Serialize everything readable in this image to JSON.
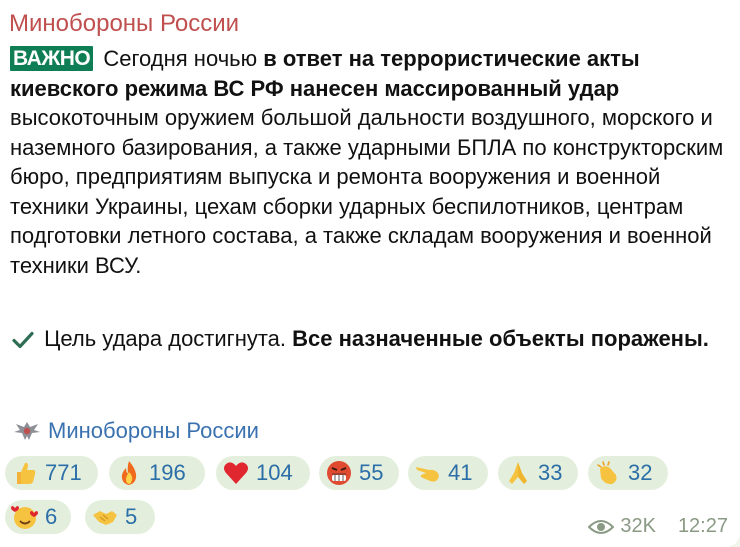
{
  "post": {
    "channel_name": "Минобороны России",
    "badge": "ВАЖНО",
    "text_1": " Сегодня ночью ",
    "text_bold_1": "в ответ на террористические акты киевского режима ВС РФ нанесен массированный удар",
    "text_2": " высокоточным оружием большой дальности воздушного, морского и наземного базирования, а также ударными БПЛА по конструкторским бюро, предприятиям выпуска и ремонта вооружения и военной техники Украины, цехам сборки ударных беспилотников, центрам подготовки летного состава, а также складам вооружения и военной техники ВСУ.",
    "check_text": " Цель удара достигнута. ",
    "check_bold": "Все назначенные объекты поражены.",
    "signature": "Минобороны России"
  },
  "reactions": [
    {
      "icon": "thumbs-up",
      "count": "771"
    },
    {
      "icon": "fire",
      "count": "196"
    },
    {
      "icon": "red-heart",
      "count": "104"
    },
    {
      "icon": "angry-face",
      "count": "55"
    },
    {
      "icon": "pointing-hand",
      "count": "41"
    },
    {
      "icon": "folded-hands",
      "count": "33"
    },
    {
      "icon": "clapping-hands",
      "count": "32"
    },
    {
      "icon": "smiling-face-with-hearts",
      "count": "6"
    },
    {
      "icon": "handshake",
      "count": "5"
    }
  ],
  "meta": {
    "views": "32K",
    "time": "12:27"
  },
  "colors": {
    "channel_name": "#c0504f",
    "badge_bg": "#0f7e54",
    "link": "#3a72b0",
    "reaction_bg": "#e3efdc",
    "meta": "#8a9a84"
  }
}
